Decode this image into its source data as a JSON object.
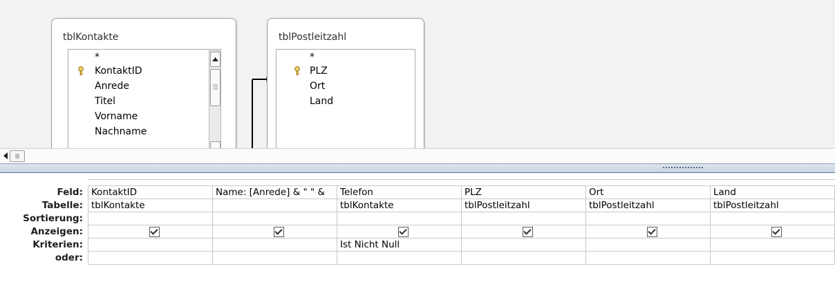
{
  "tables": [
    {
      "title": "tblKontakte",
      "fields": [
        "*",
        "KontaktID",
        "Anrede",
        "Titel",
        "Vorname",
        "Nachname"
      ],
      "key_field": "KontaktID"
    },
    {
      "title": "tblPostleitzahl",
      "fields": [
        "*",
        "PLZ",
        "Ort",
        "Land"
      ],
      "key_field": "PLZ"
    }
  ],
  "grid": {
    "row_labels": {
      "feld": "Feld:",
      "tabelle": "Tabelle:",
      "sortierung": "Sortierung:",
      "anzeigen": "Anzeigen:",
      "kriterien": "Kriterien:",
      "oder": "oder:"
    },
    "columns": [
      {
        "feld": "KontaktID",
        "tabelle": "tblKontakte",
        "sortierung": "",
        "anzeigen": true,
        "kriterien": "",
        "oder": ""
      },
      {
        "feld": "Name: [Anrede] & \" \" &",
        "tabelle": "",
        "sortierung": "",
        "anzeigen": true,
        "kriterien": "",
        "oder": ""
      },
      {
        "feld": "Telefon",
        "tabelle": "tblKontakte",
        "sortierung": "",
        "anzeigen": true,
        "kriterien": "Ist Nicht Null",
        "oder": ""
      },
      {
        "feld": "PLZ",
        "tabelle": "tblPostleitzahl",
        "sortierung": "",
        "anzeigen": true,
        "kriterien": "",
        "oder": ""
      },
      {
        "feld": "Ort",
        "tabelle": "tblPostleitzahl",
        "sortierung": "",
        "anzeigen": true,
        "kriterien": "",
        "oder": ""
      },
      {
        "feld": "Land",
        "tabelle": "tblPostleitzahl",
        "sortierung": "",
        "anzeigen": true,
        "kriterien": "",
        "oder": ""
      }
    ]
  },
  "icons": {
    "key": "key-icon",
    "scroll_up": "arrow-up-icon",
    "scroll_left": "arrow-left-icon"
  },
  "colors": {
    "splitter": "#5f7597",
    "design_background": "#f2f2f2",
    "grid_border": "#c8c8c8"
  }
}
